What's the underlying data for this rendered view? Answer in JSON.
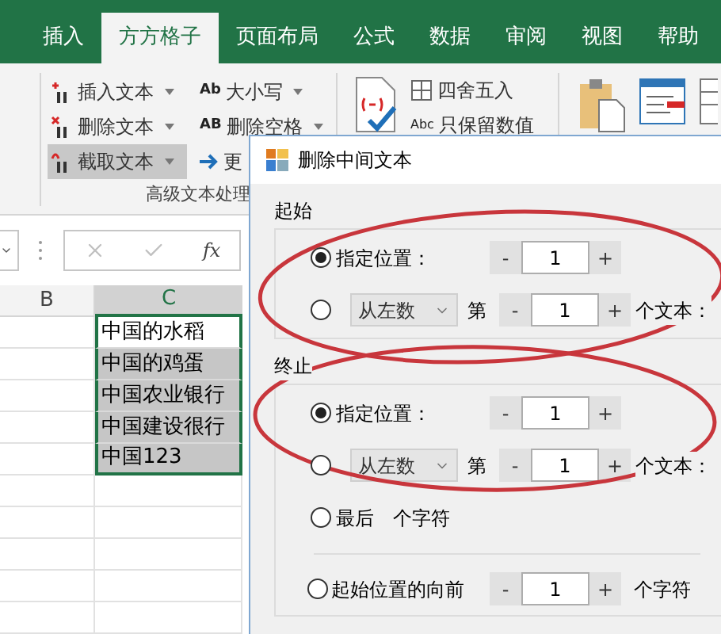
{
  "ribbon_tabs": [
    {
      "label": "插入",
      "selected": false
    },
    {
      "label": "方方格子",
      "selected": true
    },
    {
      "label": "页面布局",
      "selected": false
    },
    {
      "label": "公式",
      "selected": false
    },
    {
      "label": "数据",
      "selected": false
    },
    {
      "label": "审阅",
      "selected": false
    },
    {
      "label": "视图",
      "selected": false
    },
    {
      "label": "帮助",
      "selected": false
    }
  ],
  "ribbon": {
    "text_tools": [
      {
        "label": "插入文本",
        "selected": false
      },
      {
        "label": "删除文本",
        "selected": false
      },
      {
        "label": "截取文本",
        "selected": true
      }
    ],
    "case_tools": [
      {
        "icon_text": "Ab",
        "label": "大小写"
      },
      {
        "icon_text": "AB",
        "label": "删除空格"
      },
      {
        "label": "更"
      }
    ],
    "group_label": "高级文本处理",
    "number_tools": [
      {
        "label": "四舍五入"
      },
      {
        "icon_text": "Abc",
        "label": "只保留数值"
      }
    ]
  },
  "formula_bar": {
    "function_label": "fx"
  },
  "sheet": {
    "columns": [
      "B",
      "C"
    ],
    "cells": [
      {
        "text": "中国的水稻",
        "active": true
      },
      {
        "text": "中国的鸡蛋",
        "active": false
      },
      {
        "text": "中国农业银行",
        "active": false
      },
      {
        "text": "中国建设很行",
        "active": false
      },
      {
        "text": "中国123",
        "active": false
      }
    ]
  },
  "dialog": {
    "title": "删除中间文本",
    "sections": [
      {
        "title": "起始",
        "rows": [
          {
            "kind": "position",
            "selected": true,
            "label": "指定位置：",
            "minus": "-",
            "value": "1",
            "plus": "+"
          },
          {
            "kind": "count",
            "selected": false,
            "dropdown": "从左数",
            "ordinal": "第",
            "minus": "-",
            "value": "1",
            "plus": "+",
            "suffix": "个文本："
          }
        ]
      },
      {
        "title": "终止",
        "rows": [
          {
            "kind": "position",
            "selected": true,
            "label": "指定位置：",
            "minus": "-",
            "value": "1",
            "plus": "+"
          },
          {
            "kind": "count",
            "selected": false,
            "dropdown": "从左数",
            "ordinal": "第",
            "minus": "-",
            "value": "1",
            "plus": "+",
            "suffix": "个文本："
          },
          {
            "kind": "last",
            "selected": false,
            "label": "最后",
            "suffix": "个字符"
          }
        ]
      }
    ],
    "offset_rows": [
      {
        "selected": false,
        "label": "起始位置的向前",
        "minus": "-",
        "value": "1",
        "plus": "+",
        "suffix": "个字符"
      }
    ]
  }
}
